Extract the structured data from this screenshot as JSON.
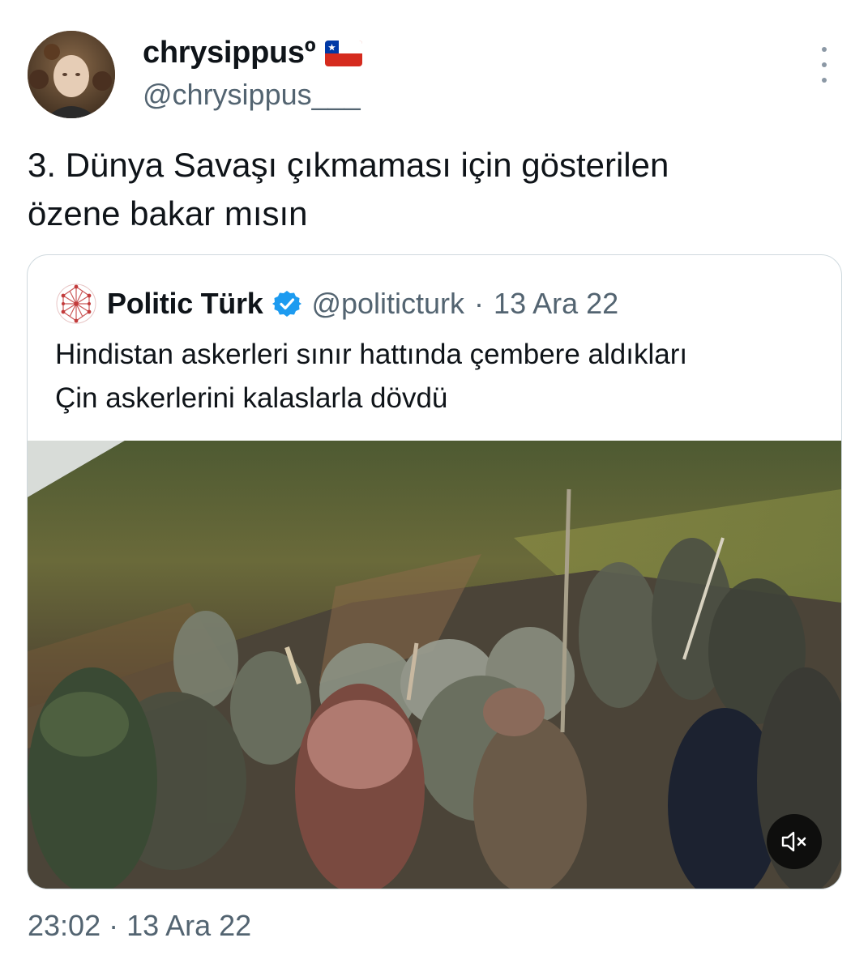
{
  "author": {
    "display_name": "chrysippusº",
    "handle": "@chrysippus___",
    "avatar_icon": "profile-photo-avatar",
    "flag_icon": "chile-flag-icon"
  },
  "tweet": {
    "text_line1": "3. Dünya Savaşı çıkmaması için gösterilen",
    "text_line2": "özene bakar mısın",
    "timestamp": "23:02 · 13 Ara 22"
  },
  "quoted": {
    "display_name": "Politic Türk",
    "handle": "@politicturk",
    "separator": "·",
    "date": "13 Ara 22",
    "text_line1": "Hindistan askerleri sınır hattında çembere aldıkları",
    "text_line2": "Çin askerlerini kalaslarla dövdü",
    "media_icon": "video-thumbnail",
    "mute_icon": "muted-speaker-icon"
  },
  "colors": {
    "text": "#0f1419",
    "secondary": "#536471",
    "border": "#cfd9de",
    "verified": "#1d9bf0"
  }
}
